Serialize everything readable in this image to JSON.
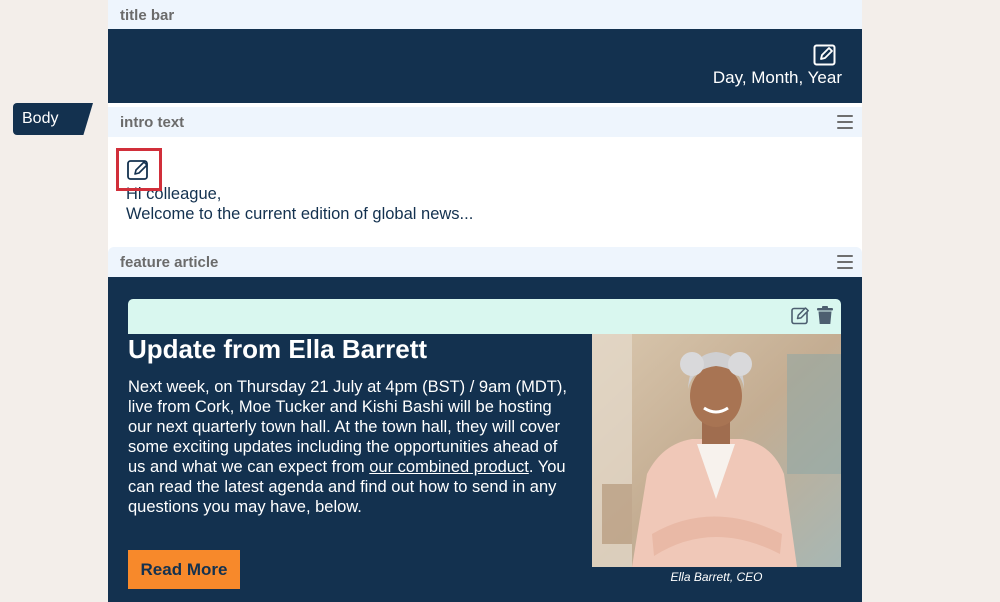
{
  "sections": {
    "title_bar": "title bar",
    "intro_text": "intro text",
    "feature_article": "feature article"
  },
  "title_block": {
    "date": "Day, Month, Year"
  },
  "body_tag": "Body",
  "intro": {
    "line1": "Hi colleague,",
    "line2": "Welcome to the current edition of global news..."
  },
  "feature": {
    "headline": "Update from Ella Barrett",
    "text_before_link": "Next week, on Thursday 21 July at 4pm (BST) / 9am (MDT), live from Cork, Moe Tucker and Kishi Bashi will be hosting our next quarterly town hall. At the town hall, they will cover some exciting updates including the opportunities ahead of us and what we can expect from ",
    "link_text": "our combined product",
    "text_after_link": ". You can read the latest agenda and find out how to send in any questions you may have, below.",
    "button_label": "Read More",
    "caption": "Ella Barrett, CEO"
  },
  "colors": {
    "navy": "#13314f",
    "section_bar": "#eef5fd",
    "card_bar": "#d9f7ef",
    "accent_orange": "#f7892b",
    "highlight_red": "#d12f3a"
  },
  "icons": [
    "edit-icon",
    "trash-icon",
    "menu-icon"
  ]
}
